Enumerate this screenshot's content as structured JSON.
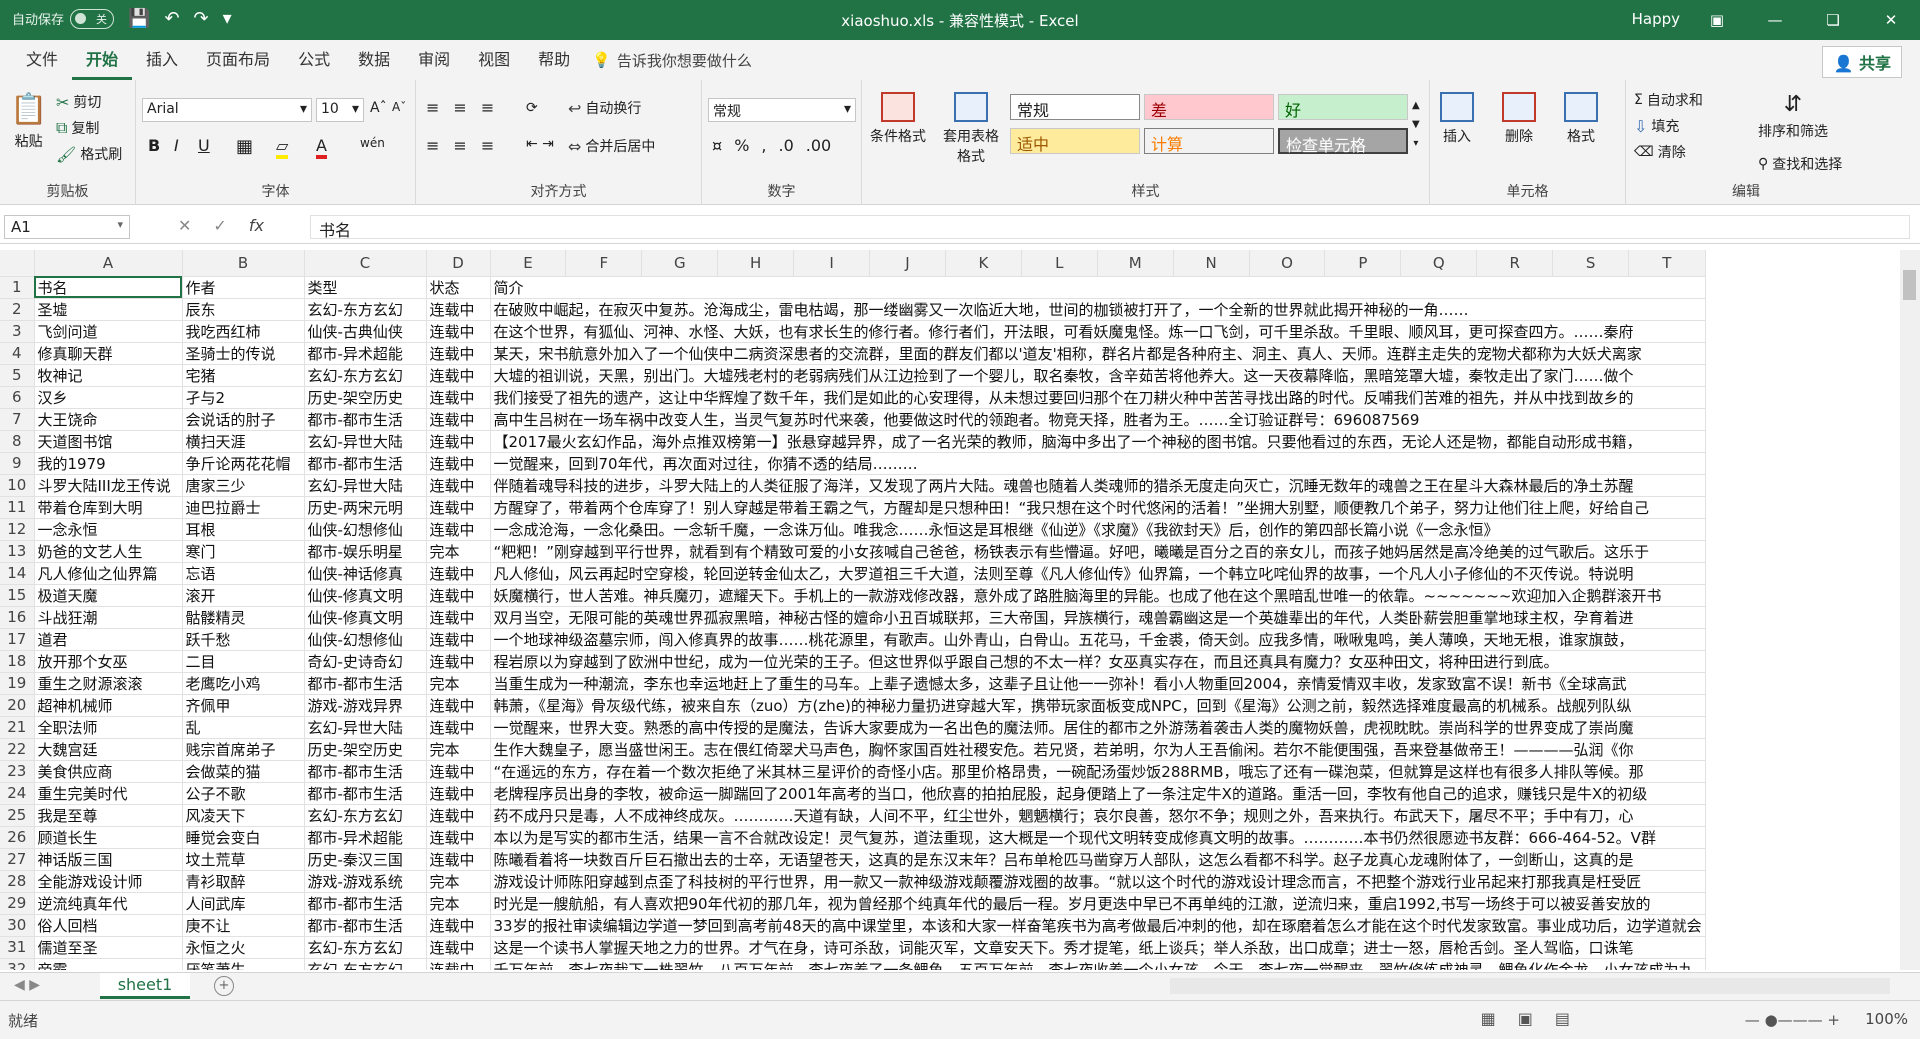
{
  "titlebar": {
    "autosave_label": "自动保存",
    "autosave_state": "关",
    "title": "xiaoshuo.xls  -  兼容性模式  -  Excel",
    "user": "Happy"
  },
  "menu": {
    "tabs": [
      "文件",
      "开始",
      "插入",
      "页面布局",
      "公式",
      "数据",
      "审阅",
      "视图",
      "帮助"
    ],
    "active_index": 1,
    "tellme": "告诉我你想要做什么",
    "share": "共享"
  },
  "ribbon": {
    "clipboard": {
      "paste": "粘贴",
      "cut": "剪切",
      "copy": "复制",
      "format_painter": "格式刷",
      "label": "剪贴板"
    },
    "font": {
      "name": "Arial",
      "size": "10",
      "label": "字体"
    },
    "align": {
      "wrap": "自动换行",
      "merge": "合并后居中",
      "label": "对齐方式"
    },
    "number": {
      "format": "常规",
      "label": "数字"
    },
    "styles": {
      "cond_format": "条件格式",
      "table_format": "套用表格格式",
      "cells": [
        "常规",
        "差",
        "好",
        "适中",
        "计算",
        "检查单元格"
      ],
      "label": "样式"
    },
    "cells": {
      "insert": "插入",
      "delete": "删除",
      "format": "格式",
      "label": "单元格"
    },
    "editing": {
      "autosum": "自动求和",
      "fill": "填充",
      "clear": "清除",
      "sort": "排序和筛选",
      "find": "查找和选择",
      "label": "编辑"
    }
  },
  "formula_bar": {
    "cell_ref": "A1",
    "content": "书名"
  },
  "columns": [
    "A",
    "B",
    "C",
    "D",
    "E",
    "F",
    "G",
    "H",
    "I",
    "J",
    "K",
    "L",
    "M",
    "N",
    "O",
    "P",
    "Q",
    "R",
    "S",
    "T"
  ],
  "rows": [
    [
      "书名",
      "作者",
      "类型",
      "状态",
      "简介"
    ],
    [
      "圣墟",
      "辰东",
      "玄幻-东方玄幻",
      "连载中",
      "在破败中崛起，在寂灭中复苏。沧海成尘，雷电枯竭，那一缕幽雾又一次临近大地，世间的枷锁被打开了，一个全新的世界就此揭开神秘的一角……"
    ],
    [
      "飞剑问道",
      "我吃西红柿",
      "仙侠-古典仙侠",
      "连载中",
      "在这个世界，有狐仙、河神、水怪、大妖，也有求长生的修行者。修行者们，开法眼，可看妖魔鬼怪。炼一口飞剑，可千里杀敌。千里眼、顺风耳，更可探查四方。……秦府"
    ],
    [
      "修真聊天群",
      "圣骑士的传说",
      "都市-异术超能",
      "连载中",
      "某天，宋书航意外加入了一个仙侠中二病资深患者的交流群，里面的群友们都以'道友'相称，群名片都是各种府主、洞主、真人、天师。连群主走失的宠物犬都称为大妖犬离家"
    ],
    [
      "牧神记",
      "宅猪",
      "玄幻-东方玄幻",
      "连载中",
      "大墟的祖训说，天黑，别出门。大墟残老村的老弱病残们从江边捡到了一个婴儿，取名秦牧，含辛茹苦将他养大。这一天夜幕降临，黑暗笼罩大墟，秦牧走出了家门……做个"
    ],
    [
      "汉乡",
      "孑与2",
      "历史-架空历史",
      "连载中",
      "我们接受了祖先的遗产，这让中华辉煌了数千年，我们是如此的心安理得，从未想过要回归那个在刀耕火种中苦苦寻找出路的时代。反哺我们苦难的祖先，并从中找到故乡的"
    ],
    [
      "大王饶命",
      "会说话的肘子",
      "都市-都市生活",
      "连载中",
      "高中生吕树在一场车祸中改变人生，当灵气复苏时代来袭，他要做这时代的领跑者。物竞天择，胜者为王。……全订验证群号：696087569"
    ],
    [
      "天道图书馆",
      "横扫天涯",
      "玄幻-异世大陆",
      "连载中",
      "【2017最火玄幻作品，海外点推双榜第一】张悬穿越异界，成了一名光荣的教师，脑海中多出了一个神秘的图书馆。只要他看过的东西，无论人还是物，都能自动形成书籍，"
    ],
    [
      "我的1979",
      "争斤论两花花帽",
      "都市-都市生活",
      "连载中",
      "一觉醒来，回到70年代，再次面对过往，你猜不透的结局………"
    ],
    [
      "斗罗大陆III龙王传说",
      "唐家三少",
      "玄幻-异世大陆",
      "连载中",
      "伴随着魂导科技的进步，斗罗大陆上的人类征服了海洋，又发现了两片大陆。魂兽也随着人类魂师的猎杀无度走向灭亡，沉睡无数年的魂兽之王在星斗大森林最后的净土苏醒"
    ],
    [
      "带着仓库到大明",
      "迪巴拉爵士",
      "历史-两宋元明",
      "连载中",
      "方醒穿了，带着两个仓库穿了！别人穿越是带着王霸之气，方醒却是只想种田！“我只想在这个时代悠闲的活着！”坐拥大别墅，顺便教几个弟子，努力让他们往上爬，好给自己"
    ],
    [
      "一念永恒",
      "耳根",
      "仙侠-幻想修仙",
      "连载中",
      "一念成沧海，一念化桑田。一念斩千魔，一念诛万仙。唯我念……永恒这是耳根继《仙逆》《求魔》《我欲封天》后，创作的第四部长篇小说《一念永恒》"
    ],
    [
      "奶爸的文艺人生",
      "寒门",
      "都市-娱乐明星",
      "完本",
      "“粑粑！”刚穿越到平行世界，就看到有个精致可爱的小女孩喊自己爸爸，杨铁表示有些懵逼。好吧，曦曦是百分之百的亲女儿，而孩子她妈居然是高冷绝美的过气歌后。这乐于"
    ],
    [
      "凡人修仙之仙界篇",
      "忘语",
      "仙侠-神话修真",
      "连载中",
      "凡人修仙，风云再起时空穿梭，轮回逆转金仙太乙，大罗道祖三千大道，法则至尊《凡人修仙传》仙界篇，一个韩立叱咤仙界的故事，一个凡人小子修仙的不灭传说。特说明"
    ],
    [
      "极道天魔",
      "滚开",
      "仙侠-修真文明",
      "连载中",
      "妖魔横行，世人苦难。神兵魔刃，遮耀天下。手机上的一款游戏修改器，意外成了路胜脑海里的异能。也成了他在这个黑暗乱世唯一的依靠。~~~~~~~欢迎加入企鹅群滚开书"
    ],
    [
      "斗战狂潮",
      "骷髅精灵",
      "仙侠-修真文明",
      "连载中",
      "双月当空，无限可能的英魂世界孤寂黑暗，神秘古怪的嬗命小丑百城联邦，三大帝国，异族横行，魂兽霸幽这是一个英雄辈出的年代，人类卧薪尝胆重掌地球主权，孕育着进"
    ],
    [
      "道君",
      "跃千愁",
      "仙侠-幻想修仙",
      "连载中",
      "一个地球神级盗墓宗师，闯入修真界的故事……桃花源里，有歌声。山外青山，白骨山。五花马，千金裘，倚天剑。应我多情，啾啾鬼鸣，美人薄唤，天地无根，谁家旗鼓，"
    ],
    [
      "放开那个女巫",
      "二目",
      "奇幻-史诗奇幻",
      "连载中",
      "程岩原以为穿越到了欧洲中世纪，成为一位光荣的王子。但这世界似乎跟自己想的不太一样？女巫真实存在，而且还真具有魔力？女巫种田文，将种田进行到底。"
    ],
    [
      "重生之财源滚滚",
      "老鹰吃小鸡",
      "都市-都市生活",
      "完本",
      "当重生成为一种潮流，李东也幸运地赶上了重生的马车。上辈子遗憾太多，这辈子且让他一一弥补！看小人物重回2004，亲情爱情双丰收，发家致富不误！新书《全球高武"
    ],
    [
      "超神机械师",
      "齐佩甲",
      "游戏-游戏异界",
      "连载中",
      "韩萧，《星海》骨灰级代练，被来自东（zuo）方(zhe)的神秘力量扔进穿越大军，携带玩家面板变成NPC，回到《星海》公测之前，毅然选择难度最高的机械系。战舰列队纵"
    ],
    [
      "全职法师",
      "乱",
      "玄幻-异世大陆",
      "连载中",
      "一觉醒来，世界大变。熟悉的高中传授的是魔法，告诉大家要成为一名出色的魔法师。居住的都市之外游荡着袭击人类的魔物妖兽，虎视眈眈。崇尚科学的世界变成了崇尚魔"
    ],
    [
      "大魏宫廷",
      "贱宗首席弟子",
      "历史-架空历史",
      "完本",
      "生作大魏皇子，愿当盛世闲王。志在偎红倚翠犬马声色，胸怀家国百姓社稷安危。若兄贤，若弟明，尔为人王吾偷闲。若尔不能便围强，吾来登基做帝王！————弘润《你"
    ],
    [
      "美食供应商",
      "会做菜的猫",
      "都市-都市生活",
      "连载中",
      "“在遥远的东方，存在着一个数次拒绝了米其林三星评价的奇怪小店。那里价格昂贵，一碗配汤蛋炒饭288RMB，哦忘了还有一碟泡菜，但就算是这样也有很多人排队等候。那"
    ],
    [
      "重生完美时代",
      "公子不歌",
      "都市-都市生活",
      "连载中",
      "老牌程序员出身的李牧，被命运一脚踹回了2001年高考的当口，他欣喜的拍拍屁股，起身便踏上了一条注定牛X的道路。重活一回，李牧有他自己的追求，赚钱只是牛X的初级"
    ],
    [
      "我是至尊",
      "风凌天下",
      "玄幻-东方玄幻",
      "连载中",
      "药不成丹只是毒，人不成神终成灰。…………天道有缺，人间不平，红尘世外，魍魉横行；哀尔良善，怒尔不争；规则之外，吾来执行。布武天下，屠尽不平；手中有刀，心"
    ],
    [
      "顾道长生",
      "睡觉会变白",
      "都市-异术超能",
      "连载中",
      "本以为是写实的都市生活，结果一言不合就改设定！灵气复苏，道法重现，这大概是一个现代文明转变成修真文明的故事。…………本书仍然很愿迹书友群：666-464-52。V群"
    ],
    [
      "神话版三国",
      "坟土荒草",
      "历史-秦汉三国",
      "连载中",
      "陈曦看着将一块数百斤巨石撤出去的士卒，无语望苍天，这真的是东汉末年？吕布单枪匹马凿穿万人部队，这怎么看都不科学。赵子龙真心龙魂附体了，一剑断山，这真的是"
    ],
    [
      "全能游戏设计师",
      "青衫取醉",
      "游戏-游戏系统",
      "完本",
      "游戏设计师陈阳穿越到点歪了科技树的平行世界，用一款又一款神级游戏颠覆游戏圈的故事。“就以这个时代的游戏设计理念而言，不把整个游戏行业吊起来打那我真是枉受匠"
    ],
    [
      "逆流纯真年代",
      "人间武库",
      "都市-都市生活",
      "完本",
      "时光是一艘航船，有人喜欢把90年代初的那几年，视为曾经那个纯真年代的最后一程。岁月更迭中早已不再单纯的江澈，逆流归来，重启1992,书写一场终于可以被妥善安放的"
    ],
    [
      "俗人回档",
      "庚不让",
      "都市-都市生活",
      "连载中",
      "33岁的报社审读编辑边学道一梦回到高考前48天的高中课堂里，本该和大家一样奋笔疾书为高考做最后冲刺的他，却在琢磨着怎么才能在这个时代发家致富。事业成功后，边学道就会"
    ],
    [
      "儒道至圣",
      "永恒之火",
      "玄幻-东方玄幻",
      "连载中",
      "这是一个读书人掌握天地之力的世界。才气在身，诗可杀敌，词能灭军，文章安天下。秀才提笔，纸上谈兵；举人杀敌，出口成章；进士一怒，唇枪舌剑。圣人驾临，口诛笔"
    ]
  ],
  "last_partial_row": [
    "帝霸",
    "厌笔萧生",
    "玄幻-东方玄幻",
    "连载中",
    "千万年前，李七夜栽下一株翠竹。八百万年前，李七夜养了一条鲤鱼。五百万年前，李七夜收养一个小女孩。今天，李七夜一觉醒来，翠竹修练成神灵，鲤鱼化作金龙，小女孩成为九"
  ],
  "sheet": {
    "name": "sheet1"
  },
  "status": {
    "ready": "就绪",
    "zoom": "100%"
  }
}
